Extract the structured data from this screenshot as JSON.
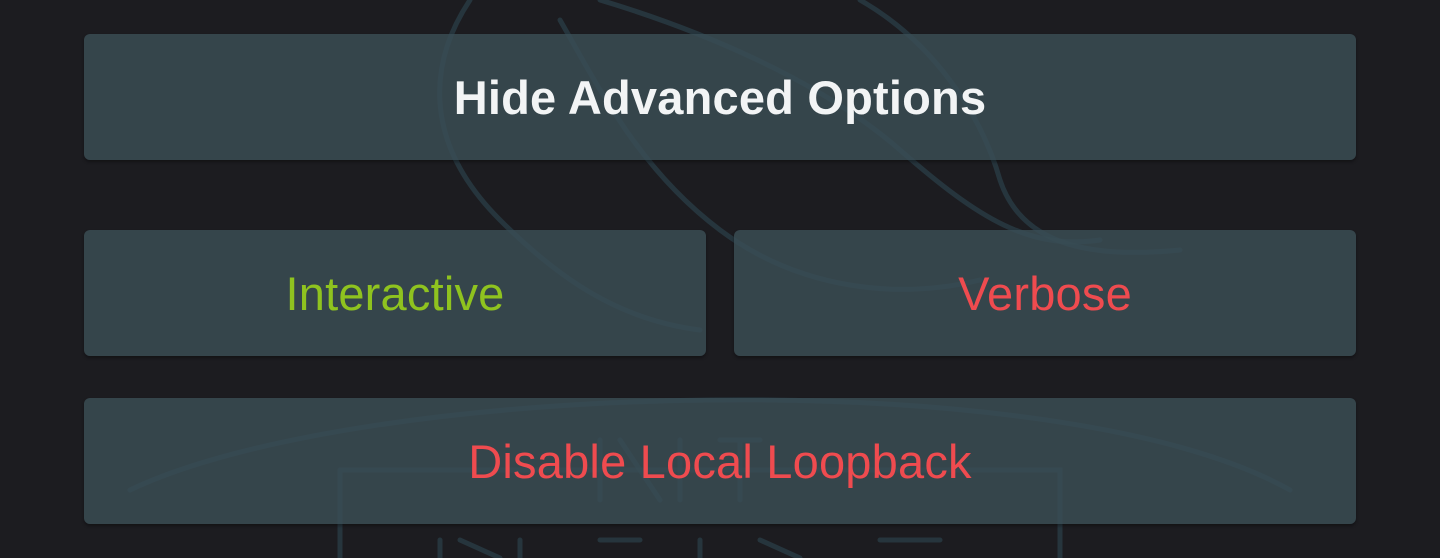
{
  "advanced_toggle": {
    "label": "Hide Advanced Options",
    "color": "#f2f4f5"
  },
  "options": {
    "interactive": {
      "label": "Interactive",
      "color": "#8fc31f",
      "enabled": true
    },
    "verbose": {
      "label": "Verbose",
      "color": "#ef4b4f",
      "enabled": false
    },
    "disable_local_loopback": {
      "label": "Disable Local Loopback",
      "color": "#ef4b4f",
      "enabled": false
    }
  },
  "colors": {
    "background": "#1c1c20",
    "button_background": "#3a4e56",
    "enabled_text": "#8fc31f",
    "disabled_text": "#ef4b4f"
  }
}
